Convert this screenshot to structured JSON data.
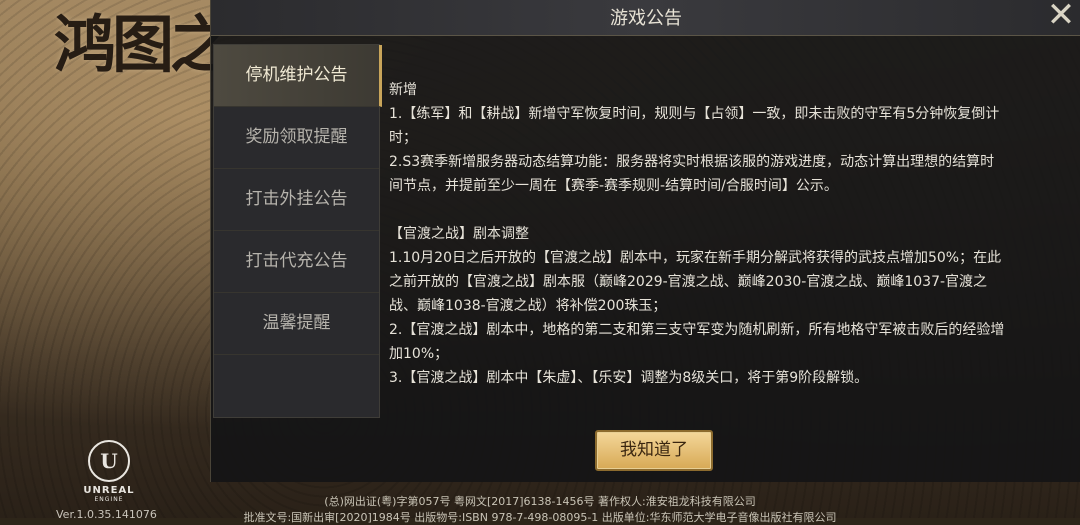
{
  "background": {
    "logo_text": "鸿图之",
    "engine_name": "UNREAL",
    "engine_sub": "ENGINE",
    "version": "Ver.1.0.35.141076",
    "footer_line1": "(总)网出证(粤)字第057号 粤网文[2017]6138-1456号 著作权人:淮安祖龙科技有限公司",
    "footer_line2": "批准文号:国新出审[2020]1984号   出版物号:ISBN 978-7-498-08095-1   出版单位:华东师范大学电子音像出版社有限公司"
  },
  "modal": {
    "title": "游戏公告",
    "close_icon": "close-x-icon",
    "tabs": [
      {
        "label": "停机维护公告",
        "active": true
      },
      {
        "label": "奖励领取提醒",
        "active": false
      },
      {
        "label": "打击外挂公告",
        "active": false
      },
      {
        "label": "打击代充公告",
        "active": false
      },
      {
        "label": "温馨提醒",
        "active": false
      }
    ],
    "content": {
      "section1_title": "新增",
      "line1a": "1.【练军】和【耕战】新增守军恢复时间，规则与【占领】一致，即未击败的守军有5分钟恢复倒计",
      "line1b": "时；",
      "line2a": "2.S3赛季新增服务器动态结算功能：服务器将实时根据该服的游戏进度，动态计算出理想的结算时",
      "line2b": "间节点，并提前至少一周在【赛季-赛季规则-结算时间/合服时间】公示。",
      "section2_title": "【官渡之战】剧本调整",
      "line3a": "1.10月20日之后开放的【官渡之战】剧本中，玩家在新手期分解武将获得的武技点增加50%；在此",
      "line3b": "之前开放的【官渡之战】剧本服（巅峰2029-官渡之战、巅峰2030-官渡之战、巅峰1037-官渡之",
      "line3c": "战、巅峰1038-官渡之战）将补偿200珠玉；",
      "line4a": "2.【官渡之战】剧本中，地格的第二支和第三支守军变为随机刷新，所有地格守军被击败后的经验增",
      "line4b": "加10%；",
      "line5": "3.【官渡之战】剧本中【朱虚】、【乐安】调整为8级关口，将于第9阶段解锁。"
    },
    "confirm_label": "我知道了"
  }
}
